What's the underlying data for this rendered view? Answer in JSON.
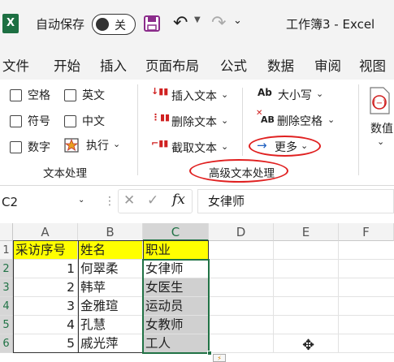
{
  "titlebar": {
    "app_icon": "X",
    "autosave_label": "自动保存",
    "autosave_state": "关",
    "doc_title": "工作簿3 - Excel",
    "icons": [
      "excel-logo-icon",
      "save-icon",
      "undo-icon",
      "redo-icon",
      "customize-toolbar-icon"
    ]
  },
  "menu": {
    "tabs": [
      "文件",
      "开始",
      "插入",
      "页面布局",
      "公式",
      "数据",
      "审阅",
      "视图"
    ]
  },
  "ribbon": {
    "checkboxes_left": [
      "空格",
      "符号",
      "数字"
    ],
    "checkboxes_right": [
      "英文",
      "中文"
    ],
    "execute_label": "执行",
    "group1_label": "文本处理",
    "insert_text": "插入文本",
    "delete_text": "删除文本",
    "extract_text": "截取文本",
    "case_icon_text": "Ab",
    "case_label": "大小写",
    "remove_spaces_icon_text": "AB",
    "remove_spaces_label": "删除空格",
    "more_label": "更多",
    "group2_label": "高级文本处理",
    "value_label": "数值"
  },
  "formula_bar": {
    "name_box": "C2",
    "formula_value": "女律师",
    "cancel_glyph": "✕",
    "enter_glyph": "✓",
    "fx_glyph": "fx"
  },
  "sheet": {
    "columns": [
      "A",
      "B",
      "C",
      "D",
      "E",
      "F"
    ],
    "row_numbers": [
      "1",
      "2",
      "3",
      "4",
      "5",
      "6"
    ],
    "headers": [
      "采访序号",
      "姓名",
      "职业"
    ],
    "rows": [
      [
        "1",
        "何翠柔",
        "女律师"
      ],
      [
        "2",
        "韩苹",
        "女医生"
      ],
      [
        "3",
        "金雅瑄",
        "运动员"
      ],
      [
        "4",
        "孔慧",
        "女教师"
      ],
      [
        "5",
        "戚光萍",
        "工人"
      ]
    ]
  },
  "colors": {
    "excel_green": "#1d6f42",
    "header_fill": "#ffff00",
    "annotation_red": "#e02020",
    "selection_gray": "#d0d0d0",
    "selection_border": "#217346"
  }
}
